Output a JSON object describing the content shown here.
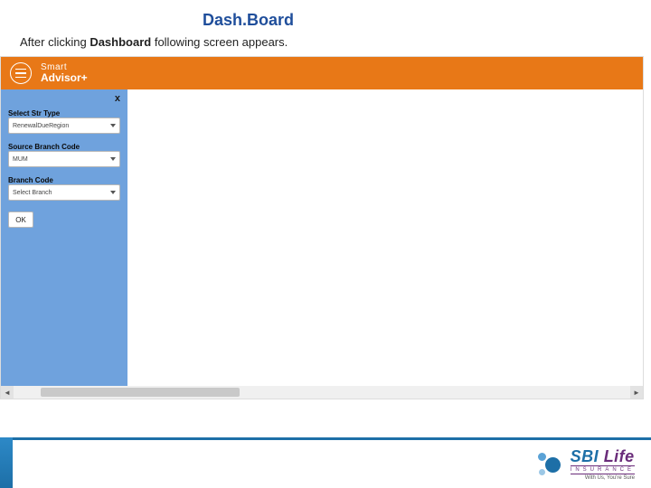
{
  "title": "Dash.Board",
  "caption": {
    "pre": "After clicking ",
    "bold": "Dashboard",
    "post": " following screen appears."
  },
  "header": {
    "brand_top": "Smart",
    "brand_bottom": "Advisor+",
    "close": "x"
  },
  "sidebar": {
    "fields": {
      "str_type": {
        "label": "Select Str Type",
        "value": "RenewalDueRegion"
      },
      "source_branch": {
        "label": "Source Branch Code",
        "value": "MUM"
      },
      "branch": {
        "label": "Branch Code",
        "value": "Select Branch"
      }
    },
    "ok": "OK"
  },
  "footer": {
    "brand": "SBI",
    "brand2": "Life",
    "tag1": "INSURANCE",
    "tag2": "With Us, You're Sure"
  }
}
